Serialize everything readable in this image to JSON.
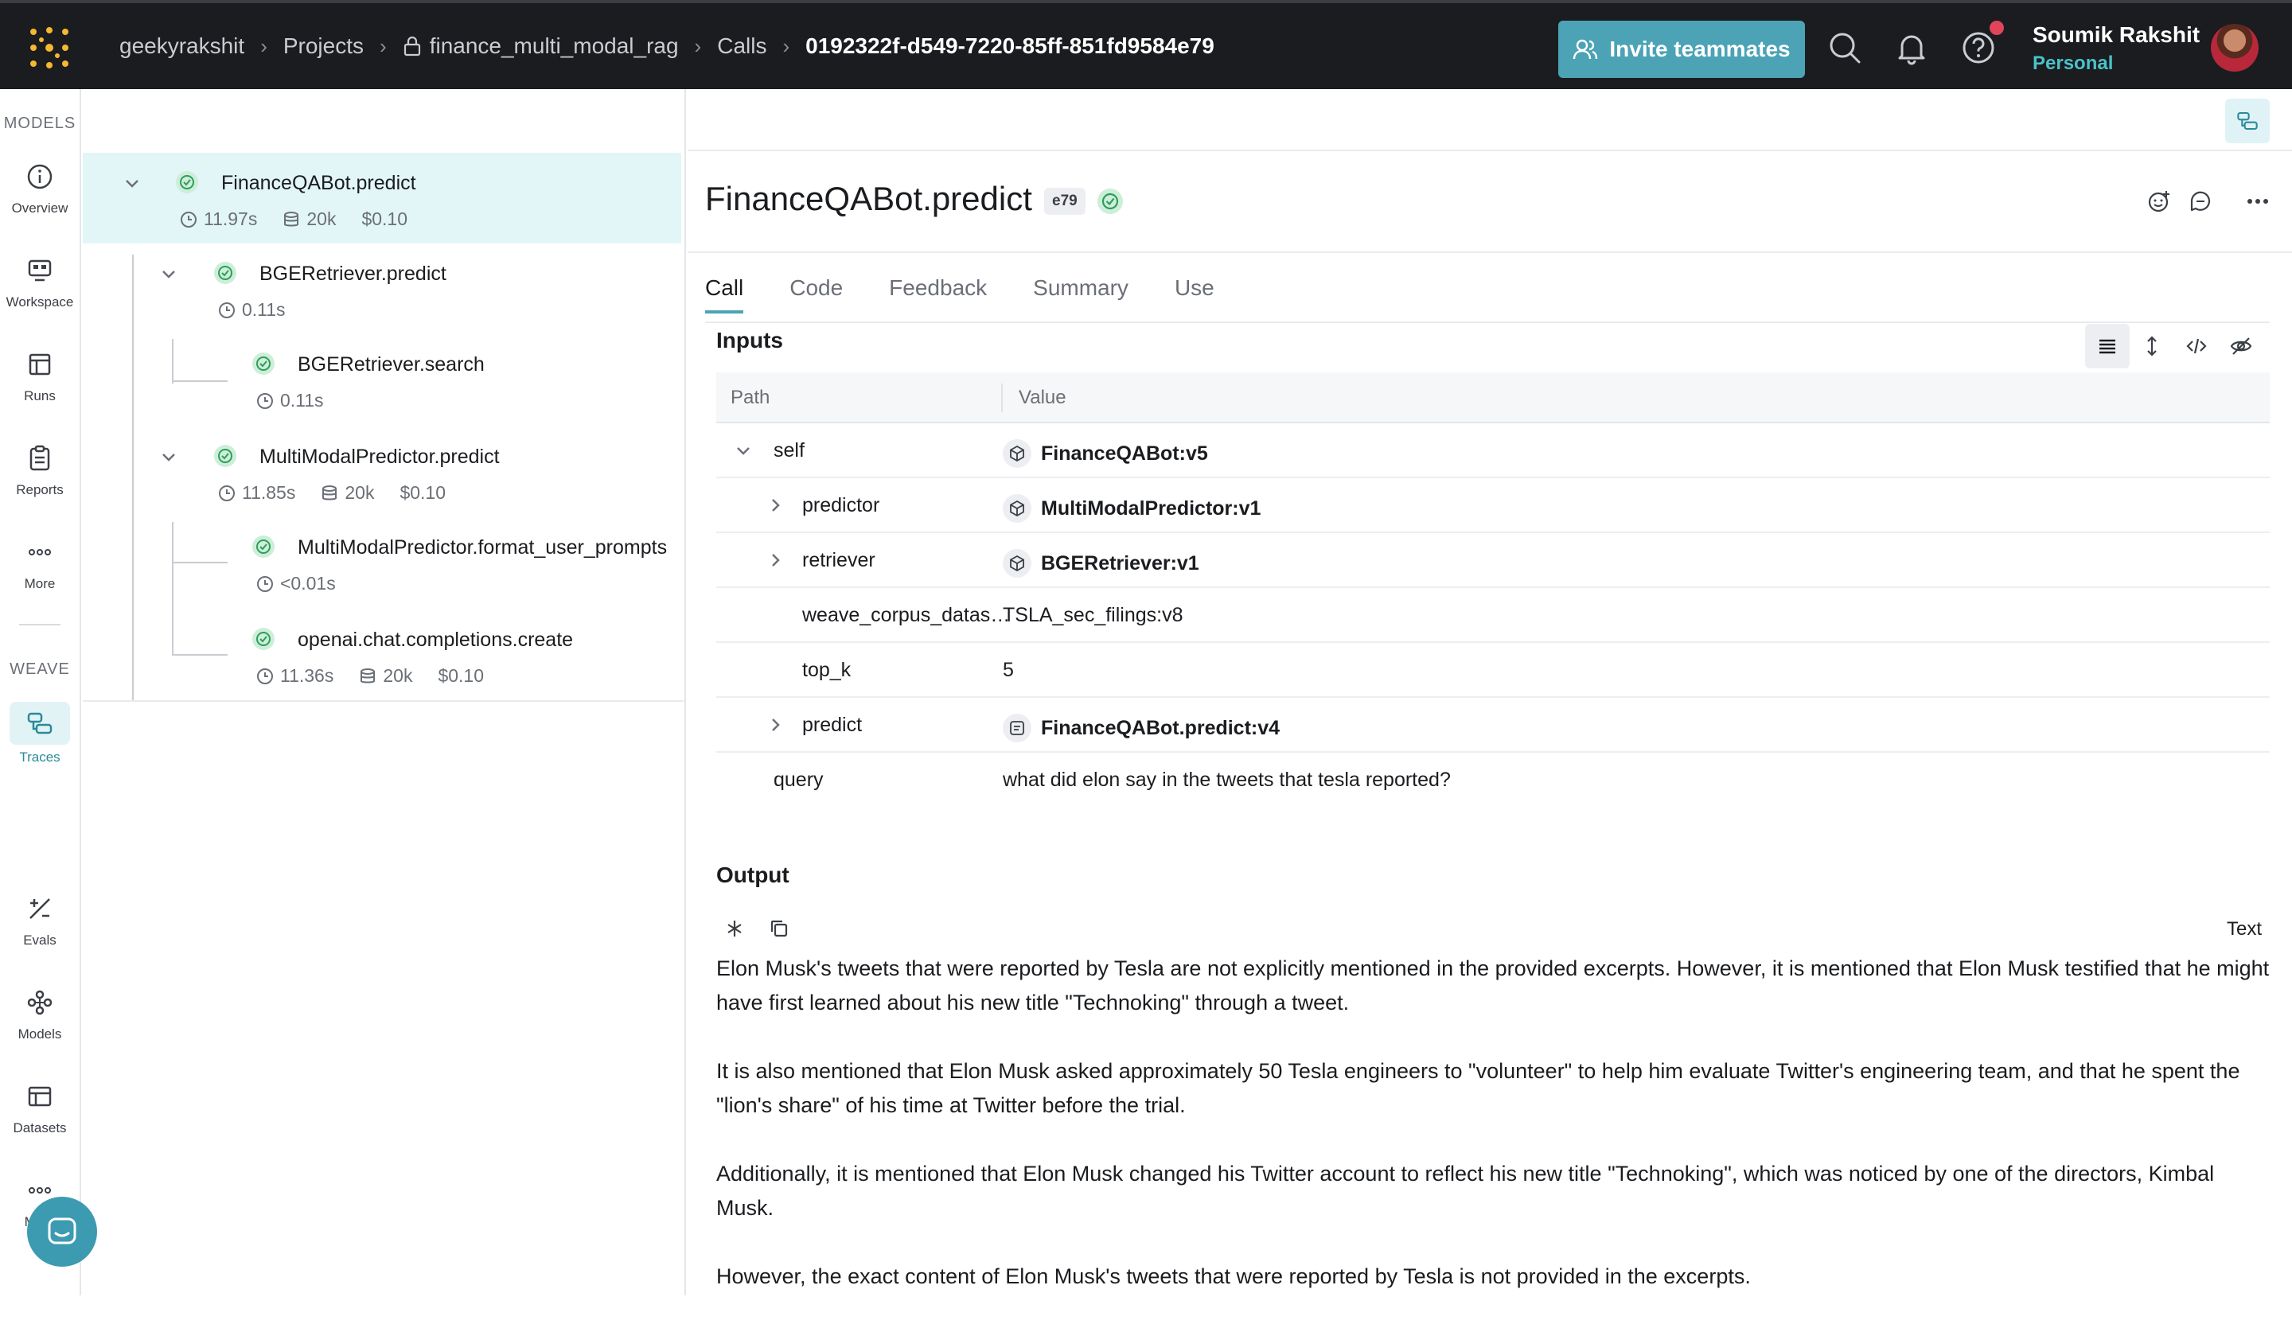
{
  "topbar": {
    "breadcrumbs": [
      "geekyrakshit",
      "Projects",
      "finance_multi_modal_rag",
      "Calls",
      "0192322f-d549-7220-85ff-851fd9584e79"
    ],
    "invite_label": "Invite teammates",
    "user_name": "Soumik Rakshit",
    "user_org": "Personal",
    "icons": [
      "apps-grid-icon",
      "lock-icon",
      "users-icon",
      "search-icon",
      "bell-icon",
      "help-icon",
      "avatar"
    ]
  },
  "leftnav": {
    "section_models": "MODELS",
    "section_weave": "WEAVE",
    "items": [
      {
        "label": "Overview",
        "icon": "info-icon"
      },
      {
        "label": "Workspace",
        "icon": "workspace-icon"
      },
      {
        "label": "Runs",
        "icon": "table-icon"
      },
      {
        "label": "Reports",
        "icon": "clipboard-icon"
      },
      {
        "label": "More",
        "icon": "dots-icon"
      },
      {
        "label": "Traces",
        "icon": "traces-icon",
        "active": true
      },
      {
        "label": "Evals",
        "icon": "evals-icon"
      },
      {
        "label": "Models",
        "icon": "models-icon"
      },
      {
        "label": "Datasets",
        "icon": "datasets-icon"
      },
      {
        "label": "More",
        "icon": "dots-icon"
      }
    ]
  },
  "tree": {
    "nodes": [
      {
        "name": "FinanceQABot.predict",
        "time": "11.97s",
        "tokens": "20k",
        "cost": "$0.10"
      },
      {
        "name": "BGERetriever.predict",
        "time": "0.11s"
      },
      {
        "name": "BGERetriever.search",
        "time": "0.11s"
      },
      {
        "name": "MultiModalPredictor.predict",
        "time": "11.85s",
        "tokens": "20k",
        "cost": "$0.10"
      },
      {
        "name": "MultiModalPredictor.format_user_prompts",
        "time": "<0.01s"
      },
      {
        "name": "openai.chat.completions.create",
        "time": "11.36s",
        "tokens": "20k",
        "cost": "$0.10"
      }
    ]
  },
  "detail": {
    "title": "FinanceQABot.predict",
    "badge": "e79",
    "tabs": [
      "Call",
      "Code",
      "Feedback",
      "Summary",
      "Use"
    ],
    "inputs_label": "Inputs",
    "col_path": "Path",
    "col_value": "Value",
    "rows": [
      {
        "key": "self",
        "value": "FinanceQABot:v5"
      },
      {
        "key": "predictor",
        "value": "MultiModalPredictor:v1"
      },
      {
        "key": "retriever",
        "value": "BGERetriever:v1"
      },
      {
        "key": "weave_corpus_datas…",
        "value": "TSLA_sec_filings:v8"
      },
      {
        "key": "top_k",
        "value": "5"
      },
      {
        "key": "predict",
        "value": "FinanceQABot.predict:v4"
      },
      {
        "key": "query",
        "value": "what did elon say in the tweets that tesla reported?"
      }
    ],
    "output_label": "Output",
    "output_format": "Text",
    "output_paragraphs": [
      "Elon Musk's tweets that were reported by Tesla are not explicitly mentioned in the provided excerpts. However, it is mentioned that Elon Musk testified that he might have first learned about his new title \"Technoking\" through a tweet.",
      "It is also mentioned that Elon Musk asked approximately 50 Tesla engineers to \"volunteer\" to help him evaluate Twitter's engineering team, and that he spent the \"lion's share\" of his time at Twitter before the trial.",
      "Additionally, it is mentioned that Elon Musk changed his Twitter account to reflect his new title \"Technoking\", which was noticed by one of the directors, Kimbal Musk.",
      "However, the exact content of Elon Musk's tweets that were reported by Tesla is not provided in the excerpts."
    ]
  }
}
